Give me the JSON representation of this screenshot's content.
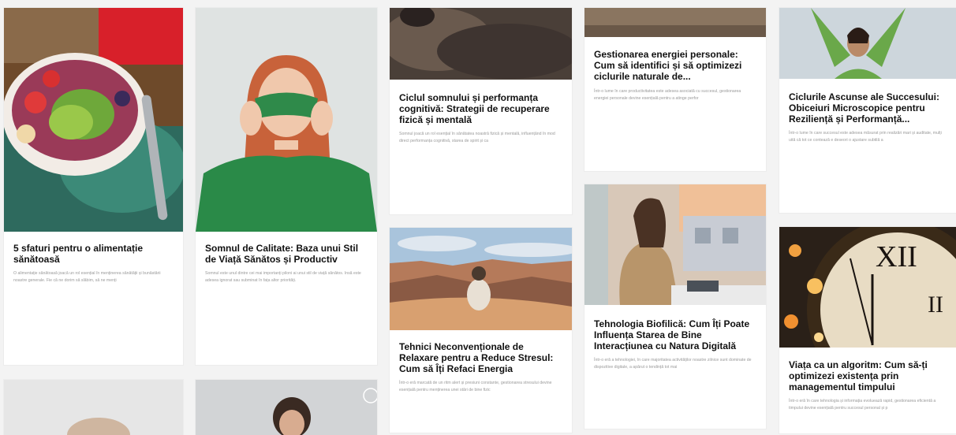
{
  "colors": {
    "page_bg": "#f3f3f3",
    "card_bg": "#ffffff",
    "title_text": "#111111",
    "excerpt_text": "#9a9a9a"
  },
  "cards": [
    {
      "title": "5 sfaturi pentru o alimentație sănătoasă",
      "excerpt": "O alimentație sănătoasă joacă un rol esențial în menținerea sănătății și bunăstării noastre generale. Fie că ne dorim să slăbim, să ne menți",
      "image": "fruit-smoothie-bowl"
    },
    {
      "title": "Somnul de Calitate: Baza unui Stil de Viață Sănătos și Productiv",
      "excerpt": "Somnul este unul dintre cei mai importanți piloni ai unui stil de viață sănătos. Insă este adesea ignorat sau subminat în fața altor priorități.",
      "image": "woman-sleep-mask"
    },
    {
      "title": "Ciclul somnului și performanța cognitivă: Strategii de recuperare fizică și mentală",
      "excerpt": "Somnul joacă un rol esențial în sănătatea noastră fizică și mentală, influențând în mod direct performanța cognitivă, starea de spirit și ca",
      "image": "sleeping-person"
    },
    {
      "title": "Tehnici Neconvenționale de Relaxare pentru a Reduce Stresul: Cum să Îți Refaci Energia",
      "excerpt": "Într-o eră marcată de un ritm alert și presiuni constante, gestionarea stresului devine esențială pentru menținerea unei stări de bine fizic",
      "image": "meditation-canyon"
    },
    {
      "title": "Gestionarea energiei personale: Cum să identifici și să optimizezi ciclurile naturale de...",
      "excerpt": "Într-o lume în care productivitatea este adesea asociată cu succesul, gestionarea energiei personale devine esențială pentru a atinge perfor",
      "image": "desk-top"
    },
    {
      "title": "Tehnologia Biofilică: Cum Îți Poate Influența Starea de Bine Interacțiunea cu Natura Digitală",
      "excerpt": "Într-o eră a tehnologiei, în care majoritatea activităților noastre zilnice sunt dominate de dispozitive digitale, a apărut o tendință tot mai",
      "image": "woman-laptop-balcony"
    },
    {
      "title": "Ciclurile Ascunse ale Succesului: Obiceiuri Microscopice pentru Reziliență și Performanță...",
      "excerpt": "Într-o lume în care succesul este adesea măsurat prin realizări mari și auditate, mulți uită că tot ce contează e deseori o ajustare subtilă a",
      "image": "woman-arms-raised"
    },
    {
      "title": "Viața ca un algoritm: Cum să-ți optimizezi existența prin managementul timpului",
      "excerpt": "Într-o eră în care tehnologia și informația evoluează rapid, gestionarea eficientă a timpului devine esențială pentru succesul personal și p",
      "image": "clock-lights"
    },
    {
      "title": "",
      "excerpt": "",
      "image": "portrait-partial-1"
    },
    {
      "title": "",
      "excerpt": "",
      "image": "portrait-partial-2"
    }
  ]
}
